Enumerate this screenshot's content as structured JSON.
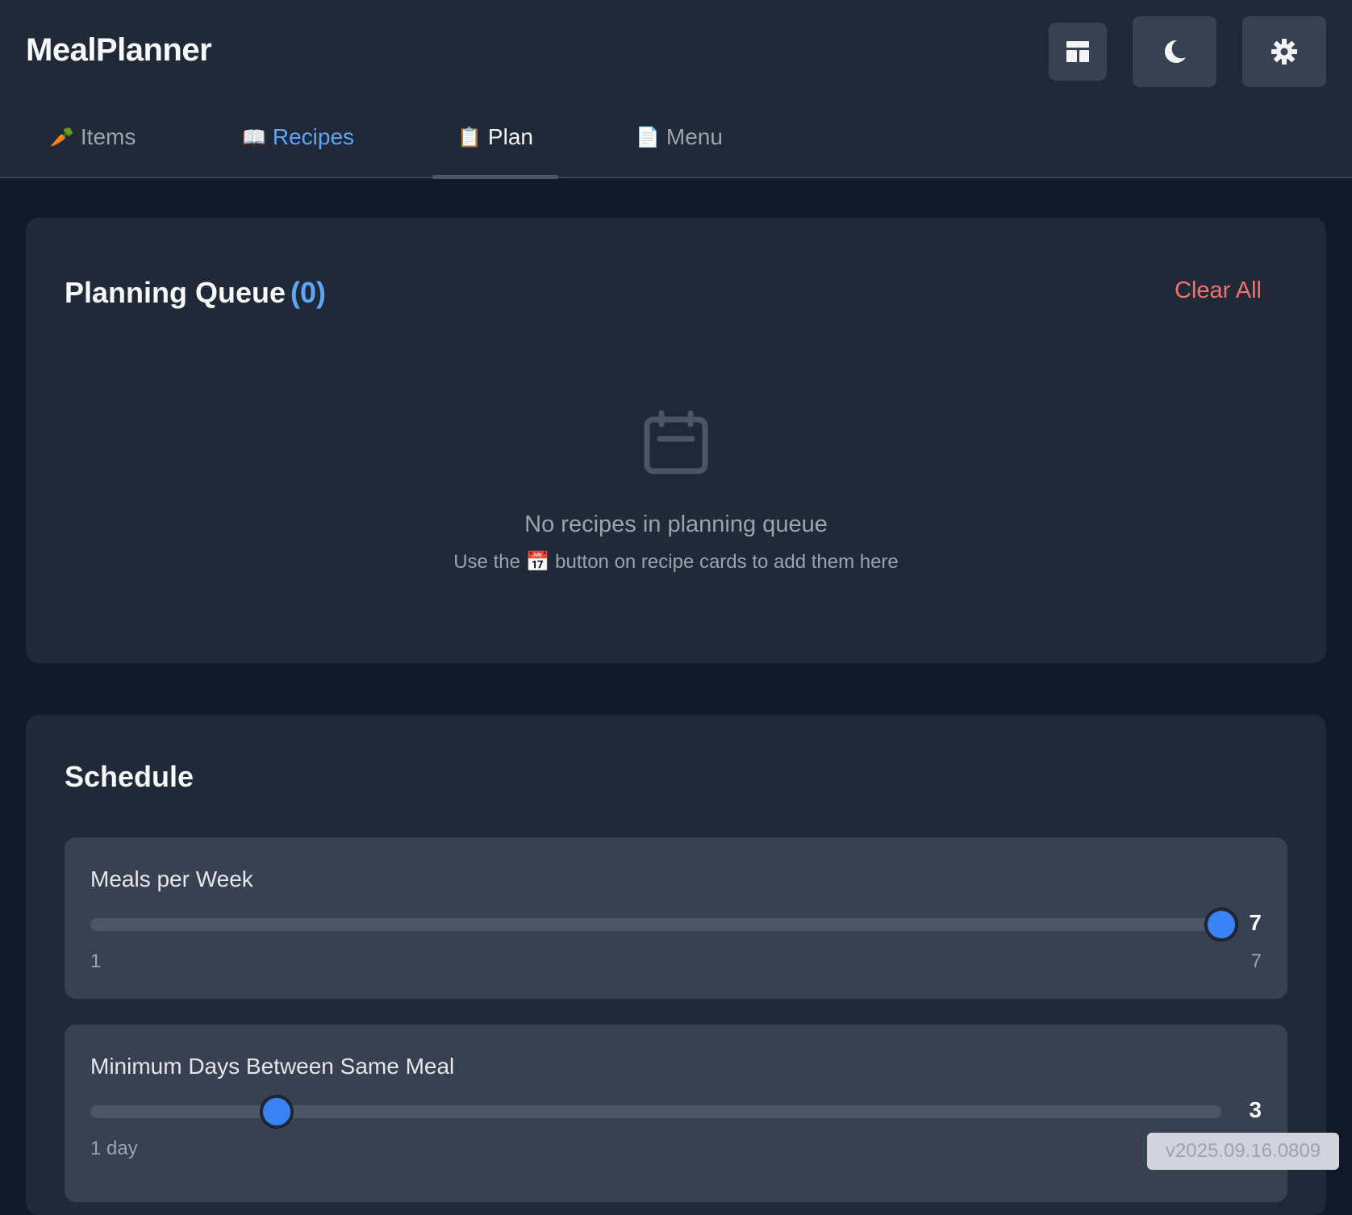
{
  "app": {
    "title": "MealPlanner"
  },
  "header": {
    "buttons": [
      {
        "icon": "layout-icon"
      },
      {
        "icon": "moon-icon"
      },
      {
        "icon": "gear-icon"
      }
    ]
  },
  "tabs": [
    {
      "emoji": "🥕",
      "label": "Items",
      "state": "default"
    },
    {
      "emoji": "📖",
      "label": "Recipes",
      "state": "highlighted"
    },
    {
      "emoji": "📋",
      "label": "Plan",
      "state": "active"
    },
    {
      "emoji": "📄",
      "label": "Menu",
      "state": "default"
    }
  ],
  "queue": {
    "title": "Planning Queue",
    "count": "(0)",
    "clear_label": "Clear All",
    "empty_icon": "calendar-icon",
    "empty_title": "No recipes in planning queue",
    "empty_sub_before": "Use the ",
    "empty_sub_emoji": "📅",
    "empty_sub_after": " button on recipe cards to add them here"
  },
  "schedule": {
    "title": "Schedule",
    "settings": [
      {
        "label": "Meals per Week",
        "value": "7",
        "value_fraction": 1.0,
        "min_label": "1",
        "max_label": "7"
      },
      {
        "label": "Minimum Days Between Same Meal",
        "value": "3",
        "value_fraction": 0.165,
        "min_label": "1 day",
        "max_label": ""
      }
    ]
  },
  "version": "v2025.09.16.0809",
  "colors": {
    "accent": "#60a5fa",
    "danger": "#f87171",
    "slider_thumb": "#3b82f6",
    "background": "#111827",
    "card": "#1f2937"
  }
}
